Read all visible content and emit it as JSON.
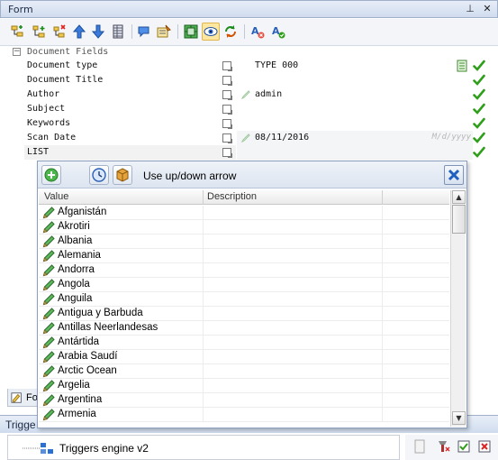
{
  "window": {
    "title": "Form",
    "pin_glyph": "⊥",
    "close_glyph": "✕"
  },
  "toolbar": {
    "icons": [
      "add-field-icon",
      "add-subfield-icon",
      "delete-field-icon",
      "move-up-icon",
      "move-down-icon",
      "table-icon",
      "comment-icon",
      "properties-icon",
      "grid-icon",
      "view-icon",
      "refresh-icon",
      "text-validation-icon",
      "text-check-icon"
    ]
  },
  "fields": {
    "section_label": "Document Fields",
    "collapse_glyph": "−",
    "rows": [
      {
        "name": "Document type",
        "value": "TYPE 000",
        "hint": "",
        "has_pencil": false,
        "has_doc_icon": true
      },
      {
        "name": "Document Title",
        "value": "",
        "hint": "",
        "has_pencil": false,
        "has_doc_icon": false
      },
      {
        "name": "Author",
        "value": "admin",
        "hint": "",
        "has_pencil": true,
        "has_doc_icon": false
      },
      {
        "name": "Subject",
        "value": "",
        "hint": "",
        "has_pencil": false,
        "has_doc_icon": false
      },
      {
        "name": "Keywords",
        "value": "",
        "hint": "",
        "has_pencil": false,
        "has_doc_icon": false
      },
      {
        "name": "Scan Date",
        "value": "08/11/2016",
        "hint": "M/d/yyyy",
        "has_pencil": true,
        "has_doc_icon": false
      },
      {
        "name": "LIST",
        "value": "",
        "hint": "",
        "has_pencil": false,
        "has_doc_icon": false
      }
    ]
  },
  "popup": {
    "hint_text": "Use up/down arrow",
    "columns": [
      "Value",
      "Description"
    ],
    "scroll_up_glyph": "▲",
    "scroll_down_glyph": "▼",
    "items": [
      {
        "value": "Afganistán",
        "description": ""
      },
      {
        "value": "Akrotiri",
        "description": ""
      },
      {
        "value": "Albania",
        "description": ""
      },
      {
        "value": "Alemania",
        "description": ""
      },
      {
        "value": "Andorra",
        "description": ""
      },
      {
        "value": "Angola",
        "description": ""
      },
      {
        "value": "Anguila",
        "description": ""
      },
      {
        "value": "Antigua y Barbuda",
        "description": ""
      },
      {
        "value": "Antillas Neerlandesas",
        "description": ""
      },
      {
        "value": "Antártida",
        "description": ""
      },
      {
        "value": "Arabia Saudí",
        "description": ""
      },
      {
        "value": "Arctic Ocean",
        "description": ""
      },
      {
        "value": "Argelia",
        "description": ""
      },
      {
        "value": "Argentina",
        "description": ""
      },
      {
        "value": "Armenia",
        "description": ""
      }
    ]
  },
  "bottom": {
    "form_tab_label": "Fo",
    "triggers_title": "Trigge",
    "tree_item": "Triggers engine v2"
  },
  "colors": {
    "check_green": "#2f9e1a",
    "pencil_green": "#3d9a2b",
    "close_blue": "#1f5fbf"
  }
}
